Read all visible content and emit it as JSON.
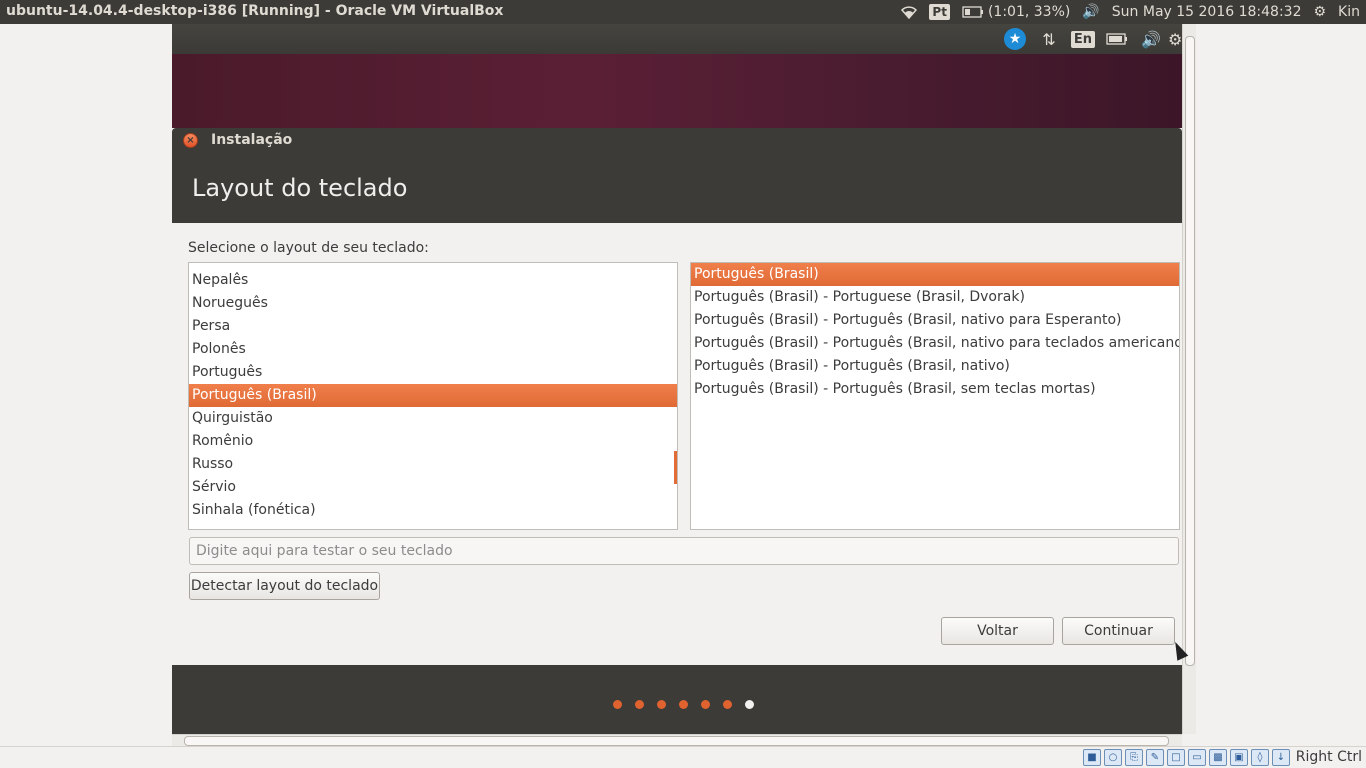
{
  "host": {
    "window_title": "ubuntu-14.04.4-desktop-i386 [Running] - Oracle VM VirtualBox",
    "tray": {
      "wifi_icon": "wifi-icon",
      "input_badge": "Pt",
      "battery": "(1:01, 33%)",
      "volume_icon": "volume-icon",
      "clock": "Sun May 15 2016 18:48:32",
      "gear_icon": "gear-icon",
      "user": "Kin"
    },
    "status_bar": {
      "host_key": "Right Ctrl"
    }
  },
  "guest_panel": {
    "accessibility_icon": "accessibility-icon",
    "network_icon": "network-updown-icon",
    "keyboard_badge": "En",
    "battery_icon": "battery-icon",
    "volume_icon": "volume-icon",
    "settings_icon": "gear-icon"
  },
  "installer": {
    "window_title": "Instalação",
    "page_title": "Layout do teclado",
    "prompt": "Selecione o layout de seu teclado:",
    "layouts": [
      {
        "label": "Nepalês",
        "selected": false
      },
      {
        "label": "Norueguês",
        "selected": false
      },
      {
        "label": "Persa",
        "selected": false
      },
      {
        "label": "Polonês",
        "selected": false
      },
      {
        "label": "Português",
        "selected": false
      },
      {
        "label": "Português (Brasil)",
        "selected": true
      },
      {
        "label": "Quirguistão",
        "selected": false
      },
      {
        "label": "Romênio",
        "selected": false
      },
      {
        "label": "Russo",
        "selected": false
      },
      {
        "label": "Sérvio",
        "selected": false
      },
      {
        "label": "Sinhala (fonética)",
        "selected": false
      }
    ],
    "variants": [
      {
        "label": "Português (Brasil)",
        "selected": true
      },
      {
        "label": "Português (Brasil) - Portuguese (Brasil, Dvorak)",
        "selected": false
      },
      {
        "label": "Português (Brasil) - Português (Brasil, nativo para Esperanto)",
        "selected": false
      },
      {
        "label": "Português (Brasil) - Português (Brasil, nativo para teclados americanos)",
        "selected": false
      },
      {
        "label": "Português (Brasil) - Português (Brasil, nativo)",
        "selected": false
      },
      {
        "label": "Português (Brasil) - Português (Brasil, sem teclas mortas)",
        "selected": false
      }
    ],
    "test_input": {
      "placeholder": "Digite aqui para testar o seu teclado",
      "value": ""
    },
    "detect_button": "Detectar layout do teclado",
    "back_button": "Voltar",
    "continue_button": "Continuar",
    "progress": {
      "total_steps": 7,
      "current_step": 7
    }
  },
  "colors": {
    "selection": "#e8733d",
    "panel": "#3c3b37",
    "dot_active": "#e0622e",
    "dot_current": "#f2f1f0"
  }
}
